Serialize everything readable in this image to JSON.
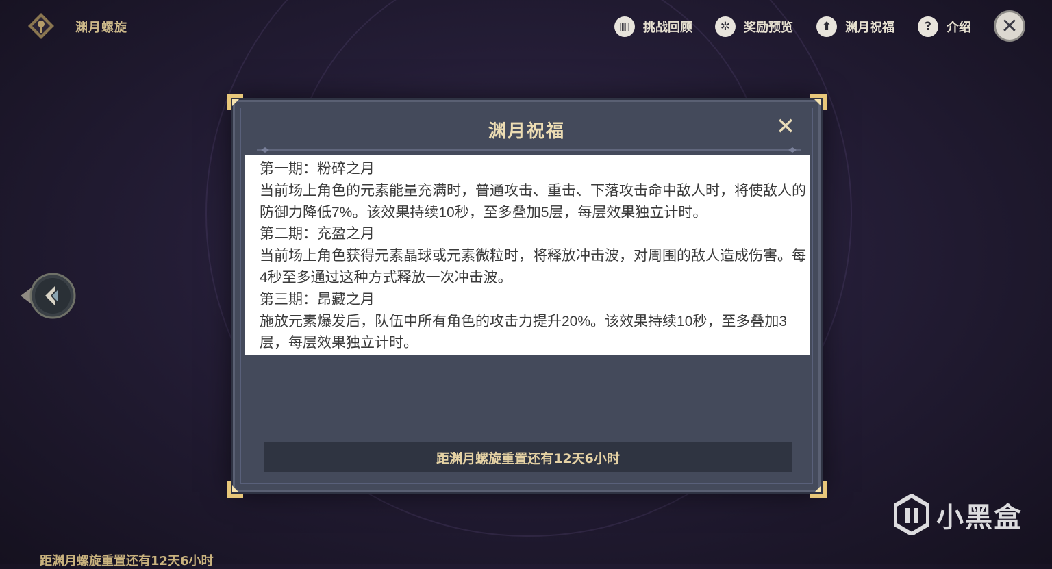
{
  "header": {
    "title": "渊月螺旋",
    "nav": [
      {
        "label": "挑战回顾",
        "icon": "book-icon"
      },
      {
        "label": "奖励预览",
        "icon": "gear-icon"
      },
      {
        "label": "渊月祝福",
        "icon": "upload-arrow-icon"
      },
      {
        "label": "介绍",
        "icon": "question-icon"
      }
    ],
    "close_icon": "close-icon"
  },
  "modal": {
    "title": "渊月祝福",
    "lines": [
      "第一期：粉碎之月",
      "当前场上角色的元素能量充满时，普通攻击、重击、下落攻击命中敌人时，将使敌人的防御力降低7%。该效果持续10秒，至多叠加5层，每层效果独立计时。",
      "第二期：充盈之月",
      "当前场上角色获得元素晶球或元素微粒时，将释放冲击波，对周围的敌人造成伤害。每4秒至多通过这种方式释放一次冲击波。",
      "第三期：昂藏之月",
      "施放元素爆发后，队伍中所有角色的攻击力提升20%。该效果持续10秒，至多叠加3层，每层效果独立计时。"
    ],
    "reset_text": "距渊月螺旋重置还有12天6小时"
  },
  "footer": {
    "timer_text": "距渊月螺旋重置还有12天6小时",
    "watermark": "小黑盒"
  },
  "colors": {
    "accent_gold": "#e5d2a4",
    "modal_bg": "#444a5b",
    "content_bg": "#ffffff"
  }
}
